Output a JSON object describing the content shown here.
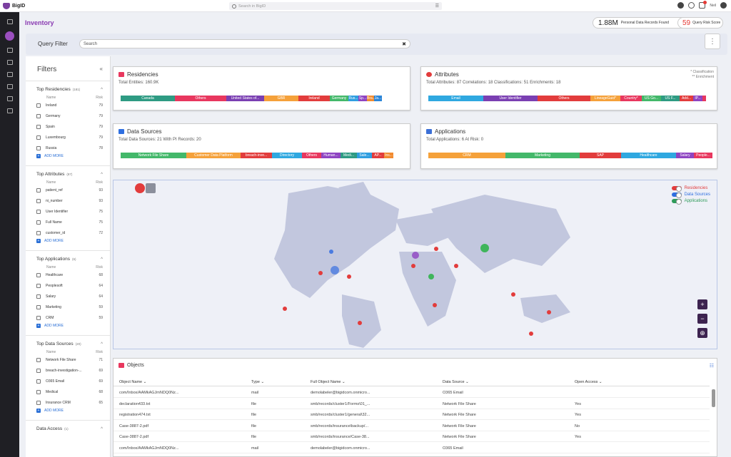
{
  "topbar": {
    "app_name": "BigID",
    "search_placeholder": "Search in BigID",
    "user_name": "Neil"
  },
  "header": {
    "title": "Inventory",
    "records_value": "1.88M",
    "records_label": "Personal Data Records Found",
    "risk_value": "59",
    "risk_label": "Query Risk Score"
  },
  "query": {
    "label": "Query Filter",
    "placeholder": "Search"
  },
  "filters": {
    "title": "Filters",
    "name_col": "Name",
    "risk_col": "Risk",
    "add_more": "ADD MORE",
    "sections": [
      {
        "title": "Top Residencies",
        "count": "(181)",
        "items": [
          [
            "Ireland",
            "79"
          ],
          [
            "Germany",
            "79"
          ],
          [
            "Spain",
            "79"
          ],
          [
            "Luxembourg",
            "79"
          ],
          [
            "Russia",
            "78"
          ]
        ]
      },
      {
        "title": "Top Attributes",
        "count": "(87)",
        "items": [
          [
            "patient_ref",
            "93"
          ],
          [
            "ni_number",
            "93"
          ],
          [
            "User Identifier",
            "75"
          ],
          [
            "Full Name",
            "75"
          ],
          [
            "customer_id",
            "72"
          ]
        ]
      },
      {
        "title": "Top Applications",
        "count": "(6)",
        "items": [
          [
            "Healthcare",
            "68"
          ],
          [
            "Peoplesoft",
            "64"
          ],
          [
            "Salary",
            "64"
          ],
          [
            "Marketing",
            "59"
          ],
          [
            "CRM",
            "59"
          ]
        ]
      },
      {
        "title": "Top Data Sources",
        "count": "(20)",
        "items": [
          [
            "Network File Share",
            "71"
          ],
          [
            "breach-investigation-...",
            "69"
          ],
          [
            "O365 Email",
            "69"
          ],
          [
            "Medical",
            "68"
          ],
          [
            "Insurance CRM",
            "65"
          ]
        ]
      },
      {
        "title": "Data Access",
        "count": "(1)",
        "items": []
      }
    ]
  },
  "residencies": {
    "title": "Residencies",
    "subtitle": "Total Entities: 160.9K",
    "segments": [
      [
        "Canada",
        "#2e9b83",
        76
      ],
      [
        "Others",
        "#e8375e",
        72
      ],
      [
        "United States of...",
        "#7a3fb2",
        53
      ],
      [
        "GBR",
        "#f5a13a",
        48
      ],
      [
        "Ireland",
        "#e23c3c",
        44
      ],
      [
        "Germany",
        "#43b86a",
        26
      ],
      [
        "Rus...",
        "#2f9ee0",
        14
      ],
      [
        "Sp...",
        "#8e44c2",
        12
      ],
      [
        "Bra...",
        "#f28b30",
        10
      ],
      [
        "Ja...",
        "#2c86d8",
        11
      ]
    ]
  },
  "attributes": {
    "title": "Attributes",
    "subtitle": "Total Attributes: 87   Correlations: 18   Classifications: 51   Enrichments: 18",
    "note1": "* Classification",
    "note2": "** Enrichment",
    "segments": [
      [
        "Email",
        "#2fa8e0",
        77
      ],
      [
        "User Identifier",
        "#7a3fb2",
        76
      ],
      [
        "Others",
        "#e23c3c",
        74
      ],
      [
        "LineageGuid*",
        "#f5a13a",
        42
      ],
      [
        "Country*",
        "#e8375e",
        30
      ],
      [
        "US Go...",
        "#43b86a",
        27
      ],
      [
        "US F...",
        "#2e9b83",
        26
      ],
      [
        "Add...",
        "#e23c3c",
        19
      ],
      [
        "IP...",
        "#8e44c2",
        13
      ],
      [
        "",
        "#e8375e",
        5
      ]
    ]
  },
  "data_sources": {
    "title": "Data Sources",
    "subtitle": "Total Data Sources: 21 With PI Records: 20",
    "segments": [
      [
        "Network File Share",
        "#43b86a",
        92
      ],
      [
        "Customer Data Platform",
        "#f5a13a",
        76
      ],
      [
        "breach-inve...",
        "#e23c3c",
        44
      ],
      [
        "Directory",
        "#2fa8e0",
        42
      ],
      [
        "Others",
        "#e8375e",
        27
      ],
      [
        "Human...",
        "#8e44c2",
        27
      ],
      [
        "Medi...",
        "#2e9b83",
        23
      ],
      [
        "Sale...",
        "#2f9ee0",
        21
      ],
      [
        "AP...",
        "#e23c3c",
        17
      ],
      [
        "Ins...",
        "#f28b30",
        13
      ]
    ]
  },
  "applications": {
    "title": "Applications",
    "subtitle": "Total Applications: 6 At Risk: 0",
    "segments": [
      [
        "CRM",
        "#f5a13a",
        108
      ],
      [
        "Marketing",
        "#43b86a",
        104
      ],
      [
        "SAP",
        "#e23c3c",
        58
      ],
      [
        "Healthcare",
        "#2fa8e0",
        77
      ],
      [
        "Salary",
        "#8e44c2",
        25
      ],
      [
        "People...",
        "#e8375e",
        26
      ]
    ]
  },
  "map": {
    "legend": [
      [
        "Residencies",
        "#e23c3c"
      ],
      [
        "Data Sources",
        "#2f6fe0"
      ],
      [
        "Applications",
        "#2e9b5a"
      ]
    ],
    "zoom_in": "+",
    "zoom_out": "−"
  },
  "objects": {
    "title": "Objects",
    "columns": [
      "Object Name",
      "Type",
      "Full Object Name",
      "Data Source",
      "Open Access"
    ],
    "rows": [
      [
        "com/Inbox/AAMkAGJmNDQ0Nz...",
        "mail",
        "demolabeler@bigidcom.onmicro...",
        "O365 Email",
        ""
      ],
      [
        "declaration433.txt",
        "file",
        "smb/records/cluster1/Forms\\01_...",
        "Network File Share",
        "Yes"
      ],
      [
        "registration474.txt",
        "file",
        "smb/records/cluster1/general\\32...",
        "Network File Share",
        "Yes"
      ],
      [
        "Case-3887-2.pdf",
        "file",
        "smb/records/insurance\\backup/...",
        "Network File Share",
        "No"
      ],
      [
        "Case-3887-2.pdf",
        "file",
        "smb/records/insurance/Case-38...",
        "Network File Share",
        "Yes"
      ],
      [
        "com/Inbox/AAMkAGJmNDQ0Nz...",
        "mail",
        "demolabeler@bigidcom.onmicro...",
        "O365 Email",
        ""
      ]
    ]
  }
}
